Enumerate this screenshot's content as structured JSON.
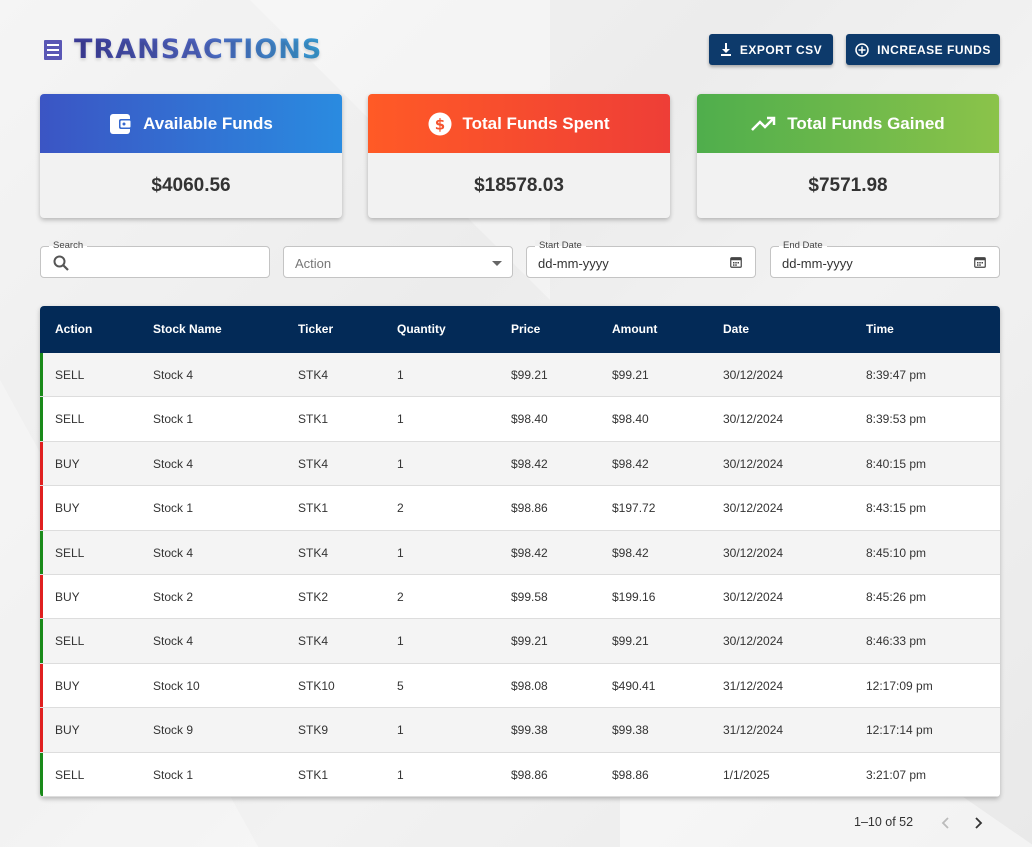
{
  "header": {
    "title": "TRANSACTIONS",
    "export_label": "EXPORT CSV",
    "increase_label": "INCREASE FUNDS"
  },
  "cards": {
    "available": {
      "label": "Available Funds",
      "value": "$4060.56",
      "icon": "wallet-icon",
      "color": "#2a8be0"
    },
    "spent": {
      "label": "Total Funds Spent",
      "value": "$18578.03",
      "icon": "dollar-icon",
      "color": "#ff5a26"
    },
    "gained": {
      "label": "Total Funds Gained",
      "value": "$7571.98",
      "icon": "trending-up-icon",
      "color": "#4fae4c"
    }
  },
  "filters": {
    "search_label": "Search",
    "search_value": "",
    "action_placeholder": "Action",
    "start_label": "Start Date",
    "start_value": "dd-mm-yyyy",
    "end_label": "End Date",
    "end_value": "dd-mm-yyyy"
  },
  "table": {
    "columns": [
      "Action",
      "Stock Name",
      "Ticker",
      "Quantity",
      "Price",
      "Amount",
      "Date",
      "Time"
    ],
    "rows": [
      {
        "action": "SELL",
        "name": "Stock 4",
        "ticker": "STK4",
        "qty": "1",
        "price": "$99.21",
        "amount": "$99.21",
        "date": "30/12/2024",
        "time": "8:39:47 pm"
      },
      {
        "action": "SELL",
        "name": "Stock 1",
        "ticker": "STK1",
        "qty": "1",
        "price": "$98.40",
        "amount": "$98.40",
        "date": "30/12/2024",
        "time": "8:39:53 pm"
      },
      {
        "action": "BUY",
        "name": "Stock 4",
        "ticker": "STK4",
        "qty": "1",
        "price": "$98.42",
        "amount": "$98.42",
        "date": "30/12/2024",
        "time": "8:40:15 pm"
      },
      {
        "action": "BUY",
        "name": "Stock 1",
        "ticker": "STK1",
        "qty": "2",
        "price": "$98.86",
        "amount": "$197.72",
        "date": "30/12/2024",
        "time": "8:43:15 pm"
      },
      {
        "action": "SELL",
        "name": "Stock 4",
        "ticker": "STK4",
        "qty": "1",
        "price": "$98.42",
        "amount": "$98.42",
        "date": "30/12/2024",
        "time": "8:45:10 pm"
      },
      {
        "action": "BUY",
        "name": "Stock 2",
        "ticker": "STK2",
        "qty": "2",
        "price": "$99.58",
        "amount": "$199.16",
        "date": "30/12/2024",
        "time": "8:45:26 pm"
      },
      {
        "action": "SELL",
        "name": "Stock 4",
        "ticker": "STK4",
        "qty": "1",
        "price": "$99.21",
        "amount": "$99.21",
        "date": "30/12/2024",
        "time": "8:46:33 pm"
      },
      {
        "action": "BUY",
        "name": "Stock 10",
        "ticker": "STK10",
        "qty": "5",
        "price": "$98.08",
        "amount": "$490.41",
        "date": "31/12/2024",
        "time": "12:17:09 pm"
      },
      {
        "action": "BUY",
        "name": "Stock 9",
        "ticker": "STK9",
        "qty": "1",
        "price": "$99.38",
        "amount": "$99.38",
        "date": "31/12/2024",
        "time": "12:17:14 pm"
      },
      {
        "action": "SELL",
        "name": "Stock 1",
        "ticker": "STK1",
        "qty": "1",
        "price": "$98.86",
        "amount": "$98.86",
        "date": "1/1/2025",
        "time": "3:21:07 pm"
      }
    ]
  },
  "pagination": {
    "text": "1–10 of 52"
  },
  "colors": {
    "header_bg": "#032a57",
    "button_bg": "#0d3a6b",
    "sell": "#1a8a1a",
    "buy": "#e02020"
  }
}
